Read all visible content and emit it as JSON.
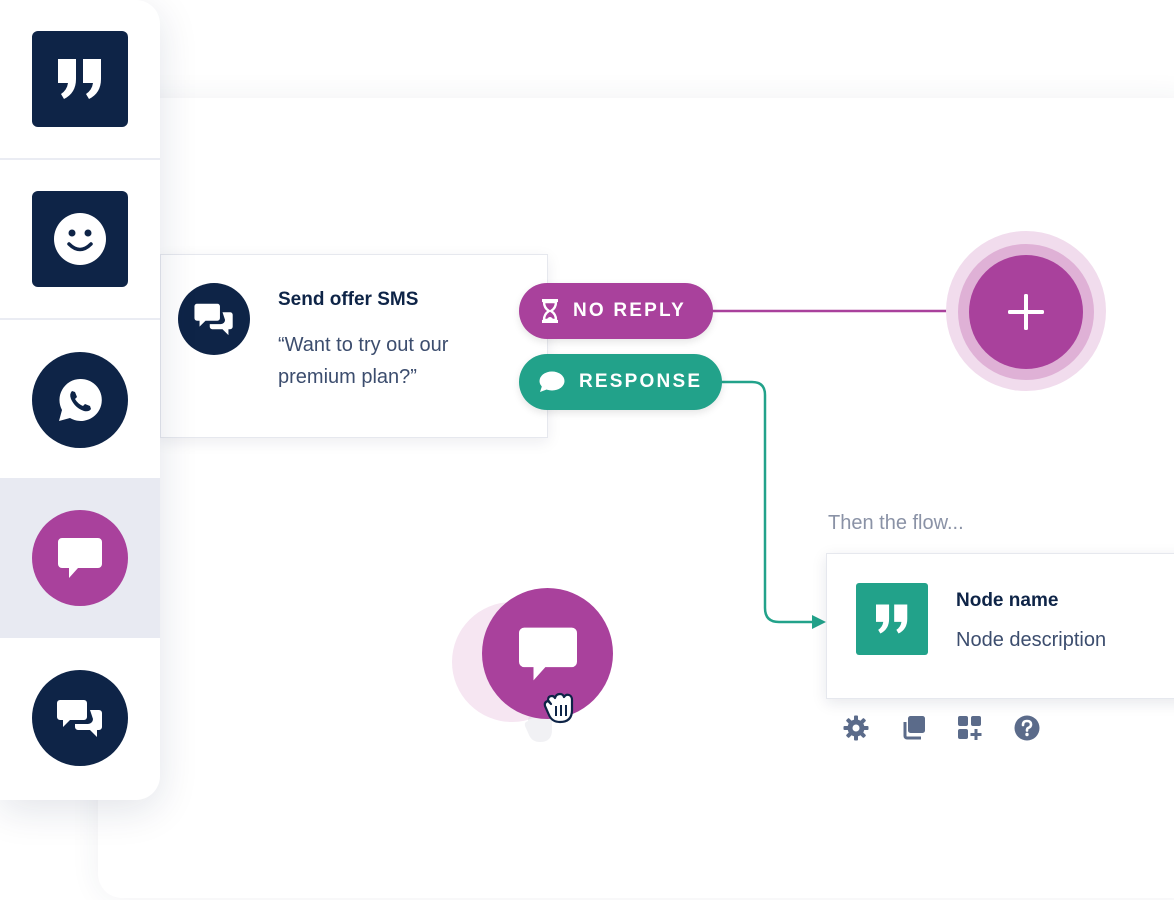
{
  "sidebar": {
    "items": [
      {
        "icon": "quote-icon",
        "shape": "square",
        "color": "#0e2447"
      },
      {
        "icon": "smiley-icon",
        "shape": "square",
        "color": "#0e2447"
      },
      {
        "icon": "whatsapp-icon",
        "shape": "circle",
        "color": "#0e2447"
      },
      {
        "icon": "sms-bubble-icon",
        "shape": "circle",
        "color": "#a9419c",
        "active": true
      },
      {
        "icon": "chat-bubbles-icon",
        "shape": "circle",
        "color": "#0e2447"
      }
    ]
  },
  "node": {
    "title": "Send offer SMS",
    "body": "“Want to try out our premium plan?”",
    "icon": "chat-bubbles-icon"
  },
  "branches": {
    "no_reply": {
      "label": "NO REPLY",
      "icon": "hourglass-icon",
      "color": "#a9419c"
    },
    "response": {
      "label": "RESPONSE",
      "icon": "speech-bubble-icon",
      "color": "#22a28a"
    }
  },
  "add_button": {
    "icon": "plus-icon"
  },
  "flow": {
    "label": "Then the flow...",
    "target": {
      "name": "Node name",
      "description": "Node description",
      "icon": "quote-icon"
    },
    "toolbar": [
      "gear-icon",
      "duplicate-icon",
      "add-widget-icon",
      "help-icon"
    ]
  },
  "dragging": {
    "icon": "sms-bubble-icon",
    "cursor": "grab-hand-icon"
  },
  "colors": {
    "navy": "#0e2447",
    "purple": "#a9419c",
    "teal": "#22a28a",
    "muted": "#8a92a6"
  }
}
